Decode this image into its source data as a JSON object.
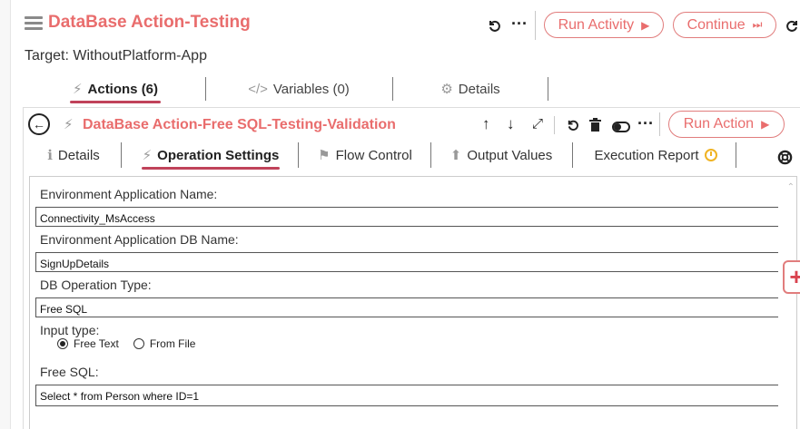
{
  "header": {
    "title": "DataBase Action-Testing",
    "undo_icon": "undo-icon",
    "more_icon": "more-icon",
    "run_activity_label": "Run Activity",
    "run_activity_icon": "▶",
    "continue_label": "Continue",
    "continue_icon": "⏭",
    "refresh_icon": "refresh-icon",
    "target_label": "Target: WithoutPlatform-App"
  },
  "tabs": [
    {
      "label": "Actions (6)",
      "icon": "⚡",
      "active": true
    },
    {
      "label": "Variables (0)",
      "icon": "</>",
      "active": false
    },
    {
      "label": "Details",
      "icon": "⚙",
      "active": false
    }
  ],
  "action": {
    "title": "DataBase Action-Free SQL-Testing-Validation",
    "run_action_label": "Run Action",
    "run_action_icon": "▶",
    "toolbar_icons": [
      "arrow-up-icon",
      "arrow-down-icon",
      "expand-icon",
      "undo-icon",
      "delete-icon",
      "toggle-icon",
      "more-icon"
    ]
  },
  "subtabs": [
    {
      "label": "Details",
      "icon": "ℹ",
      "active": false
    },
    {
      "label": "Operation Settings",
      "icon": "⚡",
      "active": true
    },
    {
      "label": "Flow Control",
      "icon": "⚑",
      "active": false
    },
    {
      "label": "Output Values",
      "icon": "⬆",
      "active": false
    },
    {
      "label": "Execution Report",
      "icon": "🕘",
      "active": false
    }
  ],
  "form": {
    "env_app_name_label": "Environment Application Name:",
    "env_app_name_value": "Connectivity_MsAccess",
    "env_app_db_label": "Environment Application DB Name:",
    "env_app_db_value": "SignUpDetails",
    "db_op_type_label": "DB Operation Type:",
    "db_op_type_value": "Free SQL",
    "input_type_label": "Input type:",
    "input_type_options": [
      "Free Text",
      "From File"
    ],
    "input_type_selected": "Free Text",
    "free_sql_label": "Free SQL:",
    "free_sql_value": "Select * from Person where ID=1"
  },
  "colors": {
    "accent": "#e96d6d",
    "tab_underline": "#c0425a",
    "pill_border": "#e17d7d"
  }
}
